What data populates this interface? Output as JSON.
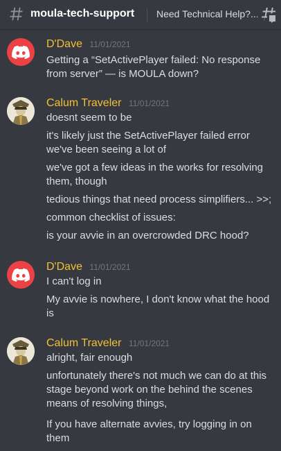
{
  "header": {
    "channel_name": "moula-tech-support",
    "topic": "Need Technical Help?...",
    "hash_icon": "hashtag-icon",
    "threads_icon": "threads-icon"
  },
  "colors": {
    "background": "#36393f",
    "username": "#f4c037",
    "timestamp": "#72767d",
    "text": "#dcddde",
    "discord_avatar": "#ed4245"
  },
  "messages": [
    {
      "author": "D'Dave",
      "timestamp": "11/01/2021",
      "avatar": "discord-logo-icon",
      "lines": [
        "Getting a “SetActivePlayer failed: No response from server” — is MOULA down?"
      ]
    },
    {
      "author": "Calum Traveler",
      "timestamp": "11/01/2021",
      "avatar": "calum-avatar",
      "lines": [
        "doesnt seem to be",
        "it's likely just the SetActivePlayer failed error we've been seeing a lot of",
        "we've got a few ideas in the works for resolving them, though",
        "tedious things that need process simplifiers... >>;",
        "common checklist of issues:",
        "is your avvie in an overcrowded DRC hood?"
      ]
    },
    {
      "author": "D'Dave",
      "timestamp": "11/01/2021",
      "avatar": "discord-logo-icon",
      "lines": [
        "I can't log in",
        "My avvie is nowhere, I don't know what the hood is"
      ]
    },
    {
      "author": "Calum Traveler",
      "timestamp": "11/01/2021",
      "avatar": "calum-avatar",
      "lines": [
        "alright, fair enough",
        "unfortunately there's not much we can do at this stage beyond work on the behind the scenes means of resolving things,",
        "If you have alternate avvies, try logging in on them"
      ]
    }
  ]
}
